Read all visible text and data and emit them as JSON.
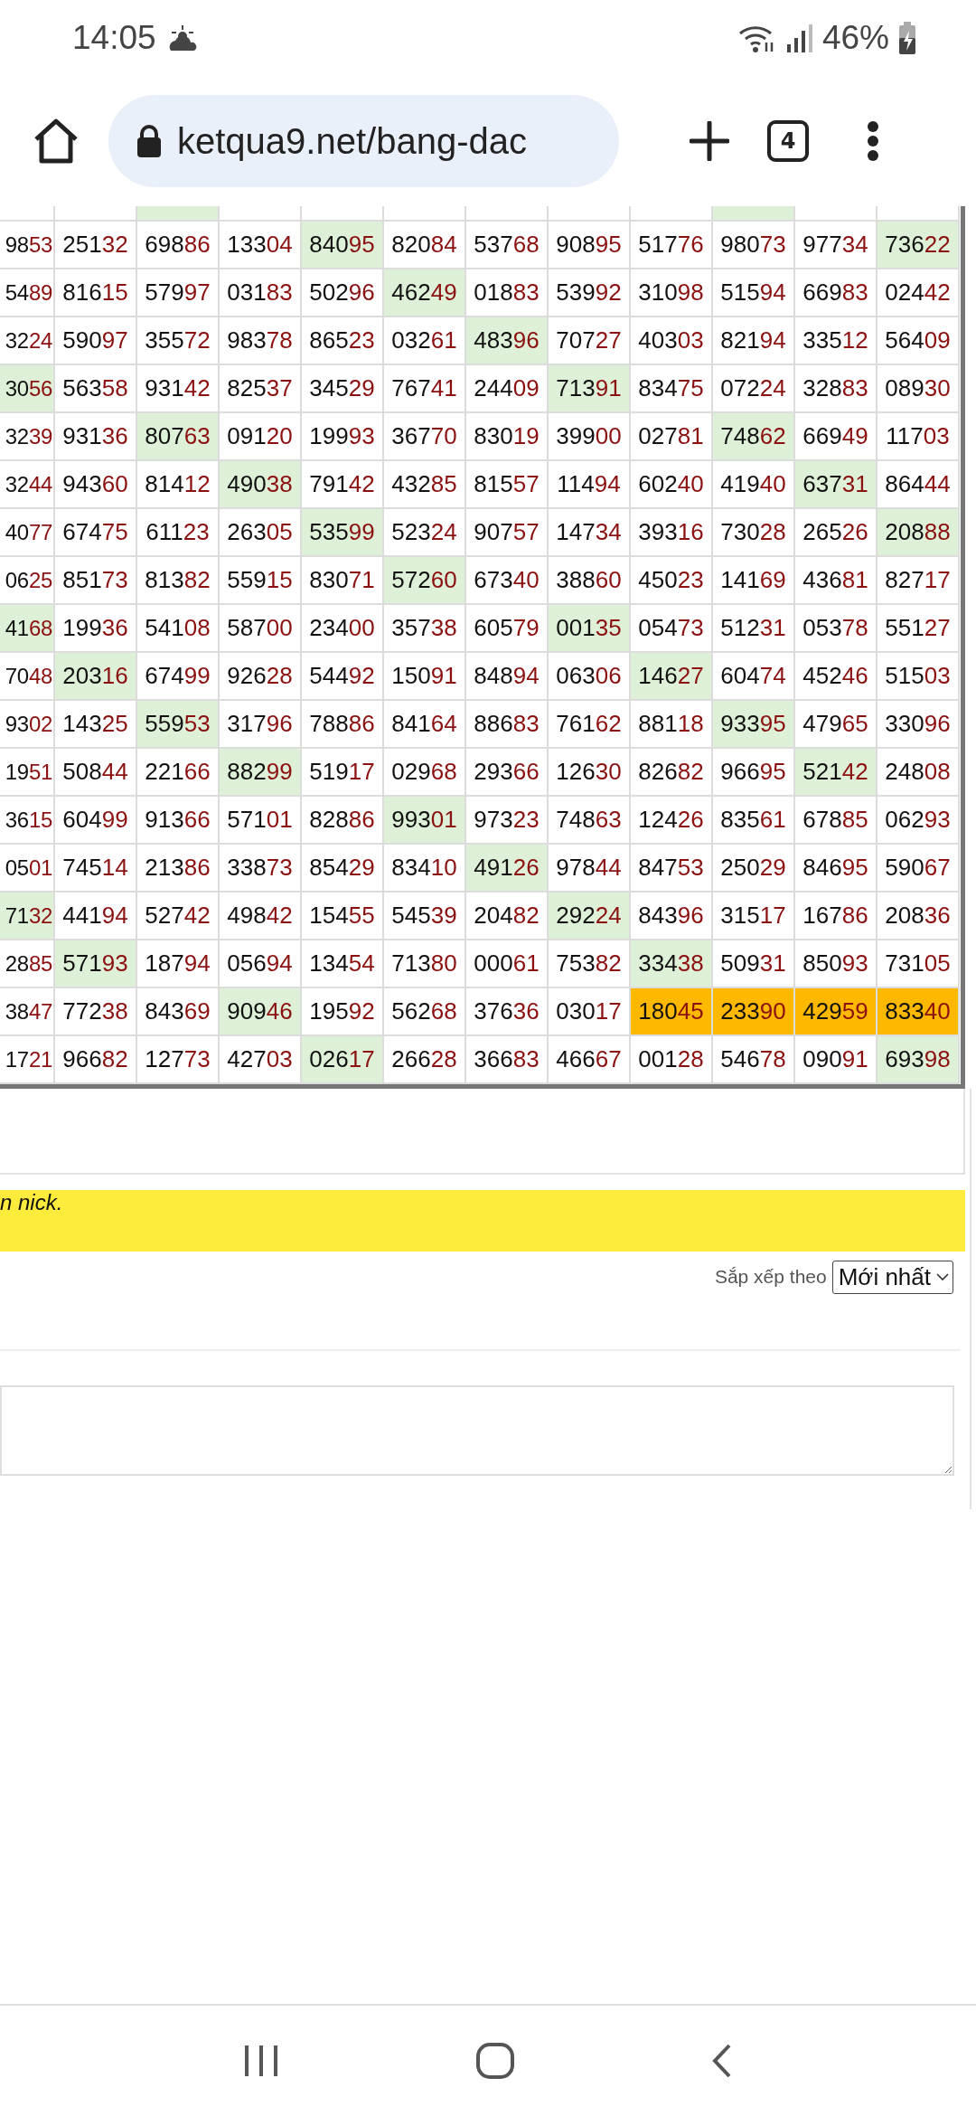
{
  "status_bar": {
    "time": "14:05",
    "battery": "46%"
  },
  "browser": {
    "url": "ketqua9.net/bang-dac",
    "tab_count": "4"
  },
  "table": {
    "partial_row": [
      {
        "color": "#ffffff"
      },
      {
        "color": "#ffffff"
      },
      {
        "color": "#dff0d8"
      },
      {
        "color": "#ffffff"
      },
      {
        "color": "#ffffff"
      },
      {
        "color": "#ffffff"
      },
      {
        "color": "#ffffff"
      },
      {
        "color": "#ffffff"
      },
      {
        "color": "#ffffff"
      },
      {
        "color": "#dff0d8"
      },
      {
        "color": "#ffffff"
      },
      {
        "color": "#ffffff"
      }
    ],
    "rows": [
      {
        "cells": [
          {
            "text": "9853",
            "color": "#ffffff"
          },
          {
            "text": "25132",
            "color": "#ffffff"
          },
          {
            "text": "69886",
            "color": "#ffffff"
          },
          {
            "text": "13304",
            "color": "#ffffff"
          },
          {
            "text": "84095",
            "color": "#dff0d8"
          },
          {
            "text": "82084",
            "color": "#ffffff"
          },
          {
            "text": "53768",
            "color": "#ffffff"
          },
          {
            "text": "90895",
            "color": "#ffffff"
          },
          {
            "text": "51776",
            "color": "#ffffff"
          },
          {
            "text": "98073",
            "color": "#ffffff"
          },
          {
            "text": "97734",
            "color": "#ffffff"
          },
          {
            "text": "73622",
            "color": "#dff0d8"
          }
        ]
      },
      {
        "cells": [
          {
            "text": "5489",
            "color": "#ffffff"
          },
          {
            "text": "81615",
            "color": "#ffffff"
          },
          {
            "text": "57997",
            "color": "#ffffff"
          },
          {
            "text": "03183",
            "color": "#ffffff"
          },
          {
            "text": "50296",
            "color": "#ffffff"
          },
          {
            "text": "46249",
            "color": "#dff0d8"
          },
          {
            "text": "01883",
            "color": "#ffffff"
          },
          {
            "text": "53992",
            "color": "#ffffff"
          },
          {
            "text": "31098",
            "color": "#ffffff"
          },
          {
            "text": "51594",
            "color": "#ffffff"
          },
          {
            "text": "66983",
            "color": "#ffffff"
          },
          {
            "text": "02442",
            "color": "#ffffff"
          }
        ]
      },
      {
        "cells": [
          {
            "text": "3224",
            "color": "#ffffff"
          },
          {
            "text": "59097",
            "color": "#ffffff"
          },
          {
            "text": "35572",
            "color": "#ffffff"
          },
          {
            "text": "98378",
            "color": "#ffffff"
          },
          {
            "text": "86523",
            "color": "#ffffff"
          },
          {
            "text": "03261",
            "color": "#ffffff"
          },
          {
            "text": "48396",
            "color": "#dff0d8"
          },
          {
            "text": "70727",
            "color": "#ffffff"
          },
          {
            "text": "40303",
            "color": "#ffffff"
          },
          {
            "text": "82194",
            "color": "#ffffff"
          },
          {
            "text": "33512",
            "color": "#ffffff"
          },
          {
            "text": "56409",
            "color": "#ffffff"
          }
        ]
      },
      {
        "cells": [
          {
            "text": "3056",
            "color": "#dff0d8"
          },
          {
            "text": "56358",
            "color": "#ffffff"
          },
          {
            "text": "93142",
            "color": "#ffffff"
          },
          {
            "text": "82537",
            "color": "#ffffff"
          },
          {
            "text": "34529",
            "color": "#ffffff"
          },
          {
            "text": "76741",
            "color": "#ffffff"
          },
          {
            "text": "24409",
            "color": "#ffffff"
          },
          {
            "text": "71391",
            "color": "#dff0d8"
          },
          {
            "text": "83475",
            "color": "#ffffff"
          },
          {
            "text": "07224",
            "color": "#ffffff"
          },
          {
            "text": "32883",
            "color": "#ffffff"
          },
          {
            "text": "08930",
            "color": "#ffffff"
          }
        ]
      },
      {
        "cells": [
          {
            "text": "3239",
            "color": "#ffffff"
          },
          {
            "text": "93136",
            "color": "#ffffff"
          },
          {
            "text": "80763",
            "color": "#dff0d8"
          },
          {
            "text": "09120",
            "color": "#ffffff"
          },
          {
            "text": "19993",
            "color": "#ffffff"
          },
          {
            "text": "36770",
            "color": "#ffffff"
          },
          {
            "text": "83019",
            "color": "#ffffff"
          },
          {
            "text": "39900",
            "color": "#ffffff"
          },
          {
            "text": "02781",
            "color": "#ffffff"
          },
          {
            "text": "74862",
            "color": "#dff0d8"
          },
          {
            "text": "66949",
            "color": "#ffffff"
          },
          {
            "text": "11703",
            "color": "#ffffff"
          }
        ]
      },
      {
        "cells": [
          {
            "text": "3244",
            "color": "#ffffff"
          },
          {
            "text": "94360",
            "color": "#ffffff"
          },
          {
            "text": "81412",
            "color": "#ffffff"
          },
          {
            "text": "49038",
            "color": "#dff0d8"
          },
          {
            "text": "79142",
            "color": "#ffffff"
          },
          {
            "text": "43285",
            "color": "#ffffff"
          },
          {
            "text": "81557",
            "color": "#ffffff"
          },
          {
            "text": "11494",
            "color": "#ffffff"
          },
          {
            "text": "60240",
            "color": "#ffffff"
          },
          {
            "text": "41940",
            "color": "#ffffff"
          },
          {
            "text": "63731",
            "color": "#dff0d8"
          },
          {
            "text": "86444",
            "color": "#ffffff"
          }
        ]
      },
      {
        "cells": [
          {
            "text": "4077",
            "color": "#ffffff"
          },
          {
            "text": "67475",
            "color": "#ffffff"
          },
          {
            "text": "61123",
            "color": "#ffffff"
          },
          {
            "text": "26305",
            "color": "#ffffff"
          },
          {
            "text": "53599",
            "color": "#dff0d8"
          },
          {
            "text": "52324",
            "color": "#ffffff"
          },
          {
            "text": "90757",
            "color": "#ffffff"
          },
          {
            "text": "14734",
            "color": "#ffffff"
          },
          {
            "text": "39316",
            "color": "#ffffff"
          },
          {
            "text": "73028",
            "color": "#ffffff"
          },
          {
            "text": "26526",
            "color": "#ffffff"
          },
          {
            "text": "20888",
            "color": "#dff0d8"
          }
        ]
      },
      {
        "cells": [
          {
            "text": "0625",
            "color": "#ffffff"
          },
          {
            "text": "85173",
            "color": "#ffffff"
          },
          {
            "text": "81382",
            "color": "#ffffff"
          },
          {
            "text": "55915",
            "color": "#ffffff"
          },
          {
            "text": "83071",
            "color": "#ffffff"
          },
          {
            "text": "57260",
            "color": "#dff0d8"
          },
          {
            "text": "67340",
            "color": "#ffffff"
          },
          {
            "text": "38860",
            "color": "#ffffff"
          },
          {
            "text": "45023",
            "color": "#ffffff"
          },
          {
            "text": "14169",
            "color": "#ffffff"
          },
          {
            "text": "43681",
            "color": "#ffffff"
          },
          {
            "text": "82717",
            "color": "#ffffff"
          }
        ]
      },
      {
        "cells": [
          {
            "text": "4168",
            "color": "#dff0d8"
          },
          {
            "text": "19936",
            "color": "#ffffff"
          },
          {
            "text": "54108",
            "color": "#ffffff"
          },
          {
            "text": "58700",
            "color": "#ffffff"
          },
          {
            "text": "23400",
            "color": "#ffffff"
          },
          {
            "text": "35738",
            "color": "#ffffff"
          },
          {
            "text": "60579",
            "color": "#ffffff"
          },
          {
            "text": "00135",
            "color": "#dff0d8"
          },
          {
            "text": "05473",
            "color": "#ffffff"
          },
          {
            "text": "51231",
            "color": "#ffffff"
          },
          {
            "text": "05378",
            "color": "#ffffff"
          },
          {
            "text": "55127",
            "color": "#ffffff"
          }
        ]
      },
      {
        "cells": [
          {
            "text": "7048",
            "color": "#ffffff"
          },
          {
            "text": "20316",
            "color": "#dff0d8"
          },
          {
            "text": "67499",
            "color": "#ffffff"
          },
          {
            "text": "92628",
            "color": "#ffffff"
          },
          {
            "text": "54492",
            "color": "#ffffff"
          },
          {
            "text": "15091",
            "color": "#ffffff"
          },
          {
            "text": "84894",
            "color": "#ffffff"
          },
          {
            "text": "06306",
            "color": "#ffffff"
          },
          {
            "text": "14627",
            "color": "#dff0d8"
          },
          {
            "text": "60474",
            "color": "#ffffff"
          },
          {
            "text": "45246",
            "color": "#ffffff"
          },
          {
            "text": "51503",
            "color": "#ffffff"
          }
        ]
      },
      {
        "cells": [
          {
            "text": "9302",
            "color": "#ffffff"
          },
          {
            "text": "14325",
            "color": "#ffffff"
          },
          {
            "text": "55953",
            "color": "#dff0d8"
          },
          {
            "text": "31796",
            "color": "#ffffff"
          },
          {
            "text": "78886",
            "color": "#ffffff"
          },
          {
            "text": "84164",
            "color": "#ffffff"
          },
          {
            "text": "88683",
            "color": "#ffffff"
          },
          {
            "text": "76162",
            "color": "#ffffff"
          },
          {
            "text": "88118",
            "color": "#ffffff"
          },
          {
            "text": "93395",
            "color": "#dff0d8"
          },
          {
            "text": "47965",
            "color": "#ffffff"
          },
          {
            "text": "33096",
            "color": "#ffffff"
          }
        ]
      },
      {
        "cells": [
          {
            "text": "1951",
            "color": "#ffffff"
          },
          {
            "text": "50844",
            "color": "#ffffff"
          },
          {
            "text": "22166",
            "color": "#ffffff"
          },
          {
            "text": "88299",
            "color": "#dff0d8"
          },
          {
            "text": "51917",
            "color": "#ffffff"
          },
          {
            "text": "02968",
            "color": "#ffffff"
          },
          {
            "text": "29366",
            "color": "#ffffff"
          },
          {
            "text": "12630",
            "color": "#ffffff"
          },
          {
            "text": "82682",
            "color": "#ffffff"
          },
          {
            "text": "96695",
            "color": "#ffffff"
          },
          {
            "text": "52142",
            "color": "#dff0d8"
          },
          {
            "text": "24808",
            "color": "#ffffff"
          }
        ]
      },
      {
        "cells": [
          {
            "text": "3615",
            "color": "#ffffff"
          },
          {
            "text": "60499",
            "color": "#ffffff"
          },
          {
            "text": "91366",
            "color": "#ffffff"
          },
          {
            "text": "57101",
            "color": "#ffffff"
          },
          {
            "text": "82886",
            "color": "#ffffff"
          },
          {
            "text": "99301",
            "color": "#dff0d8"
          },
          {
            "text": "97323",
            "color": "#ffffff"
          },
          {
            "text": "74863",
            "color": "#ffffff"
          },
          {
            "text": "12426",
            "color": "#ffffff"
          },
          {
            "text": "83561",
            "color": "#ffffff"
          },
          {
            "text": "67885",
            "color": "#ffffff"
          },
          {
            "text": "06293",
            "color": "#ffffff"
          }
        ]
      },
      {
        "cells": [
          {
            "text": "0501",
            "color": "#ffffff"
          },
          {
            "text": "74514",
            "color": "#ffffff"
          },
          {
            "text": "21386",
            "color": "#ffffff"
          },
          {
            "text": "33873",
            "color": "#ffffff"
          },
          {
            "text": "85429",
            "color": "#ffffff"
          },
          {
            "text": "83410",
            "color": "#ffffff"
          },
          {
            "text": "49126",
            "color": "#dff0d8"
          },
          {
            "text": "97844",
            "color": "#ffffff"
          },
          {
            "text": "84753",
            "color": "#ffffff"
          },
          {
            "text": "25029",
            "color": "#ffffff"
          },
          {
            "text": "84695",
            "color": "#ffffff"
          },
          {
            "text": "59067",
            "color": "#ffffff"
          }
        ]
      },
      {
        "cells": [
          {
            "text": "7132",
            "color": "#dff0d8"
          },
          {
            "text": "44194",
            "color": "#ffffff"
          },
          {
            "text": "52742",
            "color": "#ffffff"
          },
          {
            "text": "49842",
            "color": "#ffffff"
          },
          {
            "text": "15455",
            "color": "#ffffff"
          },
          {
            "text": "54539",
            "color": "#ffffff"
          },
          {
            "text": "20482",
            "color": "#ffffff"
          },
          {
            "text": "29224",
            "color": "#dff0d8"
          },
          {
            "text": "84396",
            "color": "#ffffff"
          },
          {
            "text": "31517",
            "color": "#ffffff"
          },
          {
            "text": "16786",
            "color": "#ffffff"
          },
          {
            "text": "20836",
            "color": "#ffffff"
          }
        ]
      },
      {
        "cells": [
          {
            "text": "2885",
            "color": "#ffffff"
          },
          {
            "text": "57193",
            "color": "#dff0d8"
          },
          {
            "text": "18794",
            "color": "#ffffff"
          },
          {
            "text": "05694",
            "color": "#ffffff"
          },
          {
            "text": "13454",
            "color": "#ffffff"
          },
          {
            "text": "71380",
            "color": "#ffffff"
          },
          {
            "text": "00061",
            "color": "#ffffff"
          },
          {
            "text": "75382",
            "color": "#ffffff"
          },
          {
            "text": "33438",
            "color": "#dff0d8"
          },
          {
            "text": "50931",
            "color": "#ffffff"
          },
          {
            "text": "85093",
            "color": "#ffffff"
          },
          {
            "text": "73105",
            "color": "#ffffff"
          }
        ]
      },
      {
        "cells": [
          {
            "text": "3847",
            "color": "#ffffff"
          },
          {
            "text": "77238",
            "color": "#ffffff"
          },
          {
            "text": "84369",
            "color": "#ffffff"
          },
          {
            "text": "90946",
            "color": "#dff0d8"
          },
          {
            "text": "19592",
            "color": "#ffffff"
          },
          {
            "text": "56268",
            "color": "#ffffff"
          },
          {
            "text": "37636",
            "color": "#ffffff"
          },
          {
            "text": "03017",
            "color": "#ffffff"
          },
          {
            "text": "18045",
            "color": "#ffb800"
          },
          {
            "text": "23390",
            "color": "#ffb800"
          },
          {
            "text": "42959",
            "color": "#ffb800"
          },
          {
            "text": "83340",
            "color": "#ffb800"
          }
        ]
      },
      {
        "cells": [
          {
            "text": "1721",
            "color": "#ffffff"
          },
          {
            "text": "96682",
            "color": "#ffffff"
          },
          {
            "text": "12773",
            "color": "#ffffff"
          },
          {
            "text": "42703",
            "color": "#ffffff"
          },
          {
            "text": "02617",
            "color": "#dff0d8"
          },
          {
            "text": "26628",
            "color": "#ffffff"
          },
          {
            "text": "36683",
            "color": "#ffffff"
          },
          {
            "text": "46667",
            "color": "#ffffff"
          },
          {
            "text": "00128",
            "color": "#ffffff"
          },
          {
            "text": "54678",
            "color": "#ffffff"
          },
          {
            "text": "09091",
            "color": "#ffffff"
          },
          {
            "text": "69398",
            "color": "#dff0d8"
          }
        ]
      }
    ]
  },
  "notice": {
    "text": "n nick."
  },
  "sort": {
    "label": "Sắp xếp theo",
    "value": "Mới nhất"
  }
}
